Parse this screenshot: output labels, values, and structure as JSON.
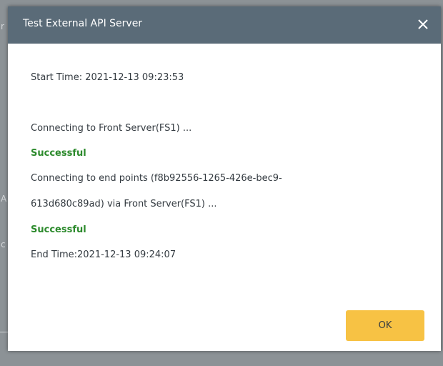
{
  "dialog": {
    "title": "Test External API Server",
    "close_icon": "close-icon",
    "lines": {
      "start_time": "Start Time: 2021-12-13 09:23:53",
      "connecting_front": "Connecting to Front Server(FS1) ...",
      "success_1": "Successful",
      "connecting_endpoints_1": "Connecting to end points (f8b92556-1265-426e-bec9-",
      "connecting_endpoints_2": "613d680c89ad) via Front Server(FS1) ...",
      "success_2": "Successful",
      "end_time": "End Time:2021-12-13 09:24:07"
    },
    "ok_label": "OK"
  },
  "colors": {
    "titlebar": "#5a6b78",
    "success": "#2c8a2c",
    "ok_button": "#f7c244",
    "backdrop": "#8c9296"
  }
}
